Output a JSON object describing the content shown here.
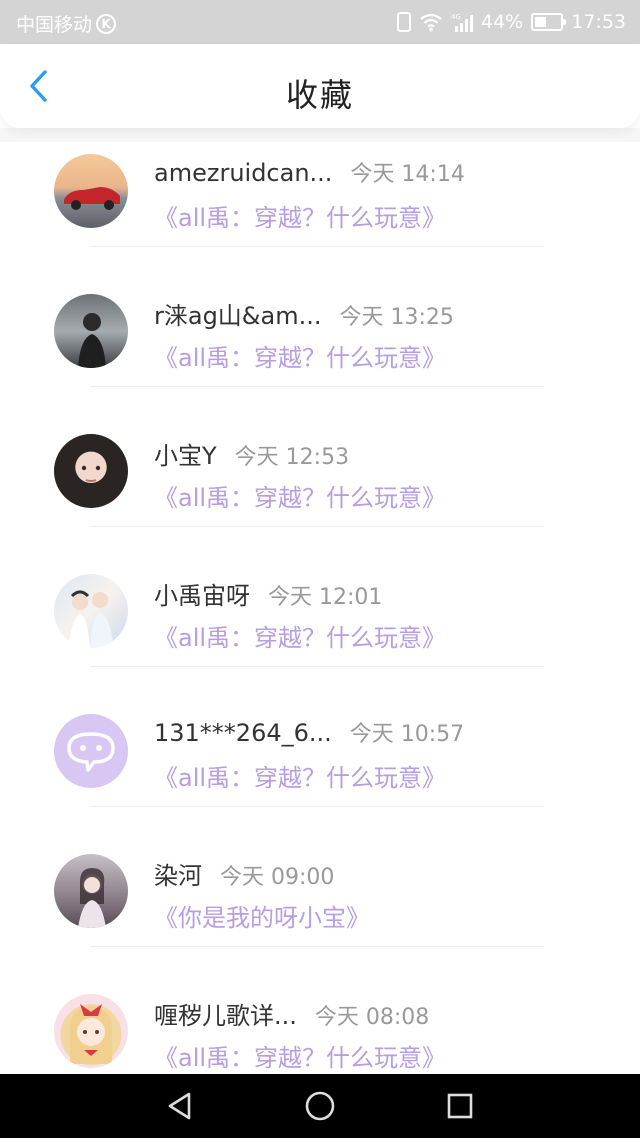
{
  "status_bar": {
    "carrier": "中国移动",
    "carrier_badge": "K",
    "network": "4G",
    "battery": "44%",
    "battery_level": 0.44,
    "time": "17:53"
  },
  "header": {
    "title": "收藏"
  },
  "items": [
    {
      "name": "amezruidcan...",
      "time": "今天 14:14",
      "title": "《all禹：穿越？什么玩意》",
      "avatar": "car-avatar"
    },
    {
      "name": "r涞ag山&am...",
      "time": "今天 13:25",
      "title": "《all禹：穿越？什么玩意》",
      "avatar": "person-avatar"
    },
    {
      "name": "小宝Y",
      "time": "今天 12:53",
      "title": "《all禹：穿越？什么玩意》",
      "avatar": "girl-avatar"
    },
    {
      "name": "小禹宙呀",
      "time": "今天 12:01",
      "title": "《all禹：穿越？什么玩意》",
      "avatar": "couple-avatar"
    },
    {
      "name": "131***264_6...",
      "time": "今天 10:57",
      "title": "《all禹：穿越？什么玩意》",
      "avatar": "default-chat-avatar"
    },
    {
      "name": "染河",
      "time": "今天 09:00",
      "title": "《你是我的呀小宝》",
      "avatar": "girl-avatar"
    },
    {
      "name": "喱秽儿歌详...",
      "time": "今天 08:08",
      "title": "《all禹：穿越？什么玩意》",
      "avatar": "anime-avatar"
    }
  ],
  "colors": {
    "accent": "#2d9cf0",
    "title_link": "#b79ee0",
    "time_text": "#999999",
    "status_bar_bg": "#d4d4d4"
  },
  "icons": {
    "back": "chevron-left-icon",
    "nav_back": "triangle-back-icon",
    "nav_home": "circle-home-icon",
    "nav_recent": "square-recent-icon"
  }
}
